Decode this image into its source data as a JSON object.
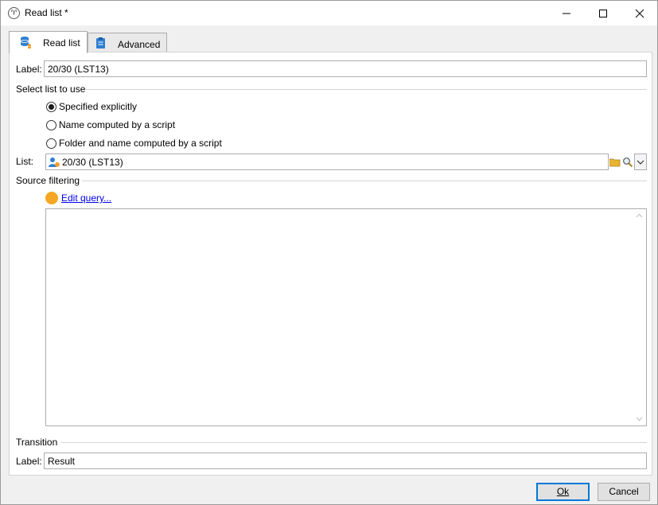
{
  "window": {
    "title": "Read list *"
  },
  "tabs": [
    {
      "label": "Read list",
      "icon": "database-user-icon",
      "active": true
    },
    {
      "label": "Advanced",
      "icon": "clipboard-icon",
      "active": false
    }
  ],
  "form": {
    "label_caption": "Label:",
    "label_value": "20/30 (LST13)",
    "select_list_section": "Select list to use",
    "options": [
      {
        "label": "Specified explicitly",
        "checked": true
      },
      {
        "label": "Name computed by a script",
        "checked": false
      },
      {
        "label": "Folder and name computed by a script",
        "checked": false
      }
    ],
    "list_caption": "List:",
    "list_value": "20/30 (LST13)",
    "source_filtering_section": "Source filtering",
    "edit_query_link": "Edit query...",
    "transition_section": "Transition",
    "transition_label_caption": "Label:",
    "transition_label_value": "Result"
  },
  "buttons": {
    "ok": "Ok",
    "cancel": "Cancel"
  },
  "colors": {
    "accent": "#0078d7",
    "filter_dot": "#f5a623",
    "link": "#0000ee"
  }
}
